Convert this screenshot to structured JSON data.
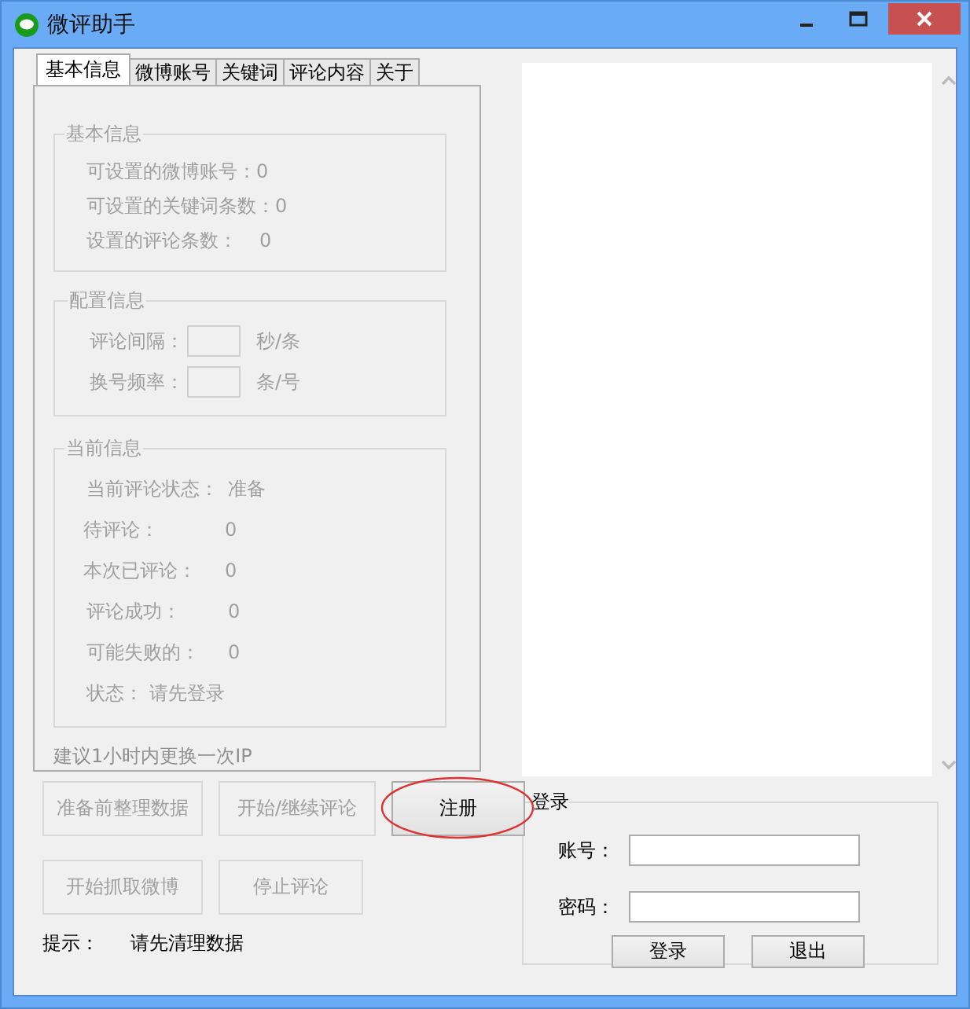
{
  "window": {
    "title": "微评助手"
  },
  "tabs": [
    {
      "label": "基本信息",
      "selected": true
    },
    {
      "label": "微博账号",
      "selected": false
    },
    {
      "label": "关键词",
      "selected": false
    },
    {
      "label": "评论内容",
      "selected": false
    },
    {
      "label": "关于",
      "selected": false
    }
  ],
  "basic_info": {
    "title": "基本信息",
    "rows": [
      {
        "label": "可设置的微博账号：",
        "value": "0"
      },
      {
        "label": "可设置的关键词条数：",
        "value": "0"
      },
      {
        "label": "设置的评论条数：",
        "value": "0"
      }
    ]
  },
  "config": {
    "title": "配置信息",
    "rows": [
      {
        "label": "评论间隔：",
        "unit": "秒/条"
      },
      {
        "label": "换号频率：",
        "unit": "条/号"
      }
    ]
  },
  "current": {
    "title": "当前信息",
    "rows": [
      {
        "label": "当前评论状态：",
        "value": "准备"
      },
      {
        "label": "待评论：",
        "value": "0"
      },
      {
        "label": "本次已评论：",
        "value": "0"
      },
      {
        "label": "评论成功：",
        "value": "0"
      },
      {
        "label": "可能失败的：",
        "value": "0"
      },
      {
        "label": "状态：",
        "value": "请先登录"
      }
    ]
  },
  "tip_ip": "建议1小时内更换一次IP",
  "buttons": [
    {
      "label": "准备前整理数据",
      "disabled": true
    },
    {
      "label": "开始/继续评论",
      "disabled": true
    },
    {
      "label": "注册",
      "disabled": false,
      "circled": true
    },
    {
      "label": "开始抓取微博",
      "disabled": true
    },
    {
      "label": "停止评论",
      "disabled": true
    }
  ],
  "hint": {
    "label": "提示：",
    "value": "请先清理数据"
  },
  "login": {
    "title": "登录",
    "fields": [
      {
        "label": "账号："
      },
      {
        "label": "密码："
      }
    ],
    "buttons": [
      "登录",
      "退出"
    ]
  }
}
